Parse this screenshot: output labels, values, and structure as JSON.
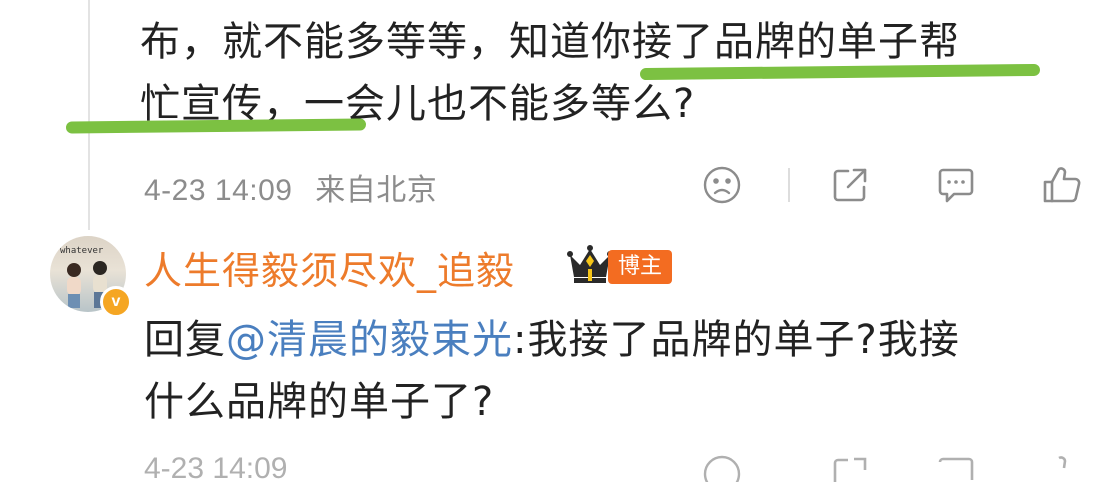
{
  "comment": {
    "line1": "布，就不能多等等，知道你接了品牌的单子帮",
    "line2": "忙宣传，一会儿也不能多等么?",
    "timestamp": "4-23 14:09",
    "location": "来自北京",
    "highlight_color": "#7cc142"
  },
  "actions": [
    "sad-icon",
    "share-icon",
    "comment-icon",
    "like-icon"
  ],
  "reply": {
    "username": "人生得毅须尽欢_追毅",
    "badge": "博主",
    "avatar_text": "whatever",
    "verified_mark": "v",
    "prefix": "回复",
    "mention": "@清晨的毅束光",
    "line1_rest": ":我接了品牌的单子?我接",
    "line2": "什么品牌的单子了?",
    "username_color": "#ed7b2b",
    "mention_color": "#4a7fbf",
    "badge_color": "#f36c21"
  }
}
